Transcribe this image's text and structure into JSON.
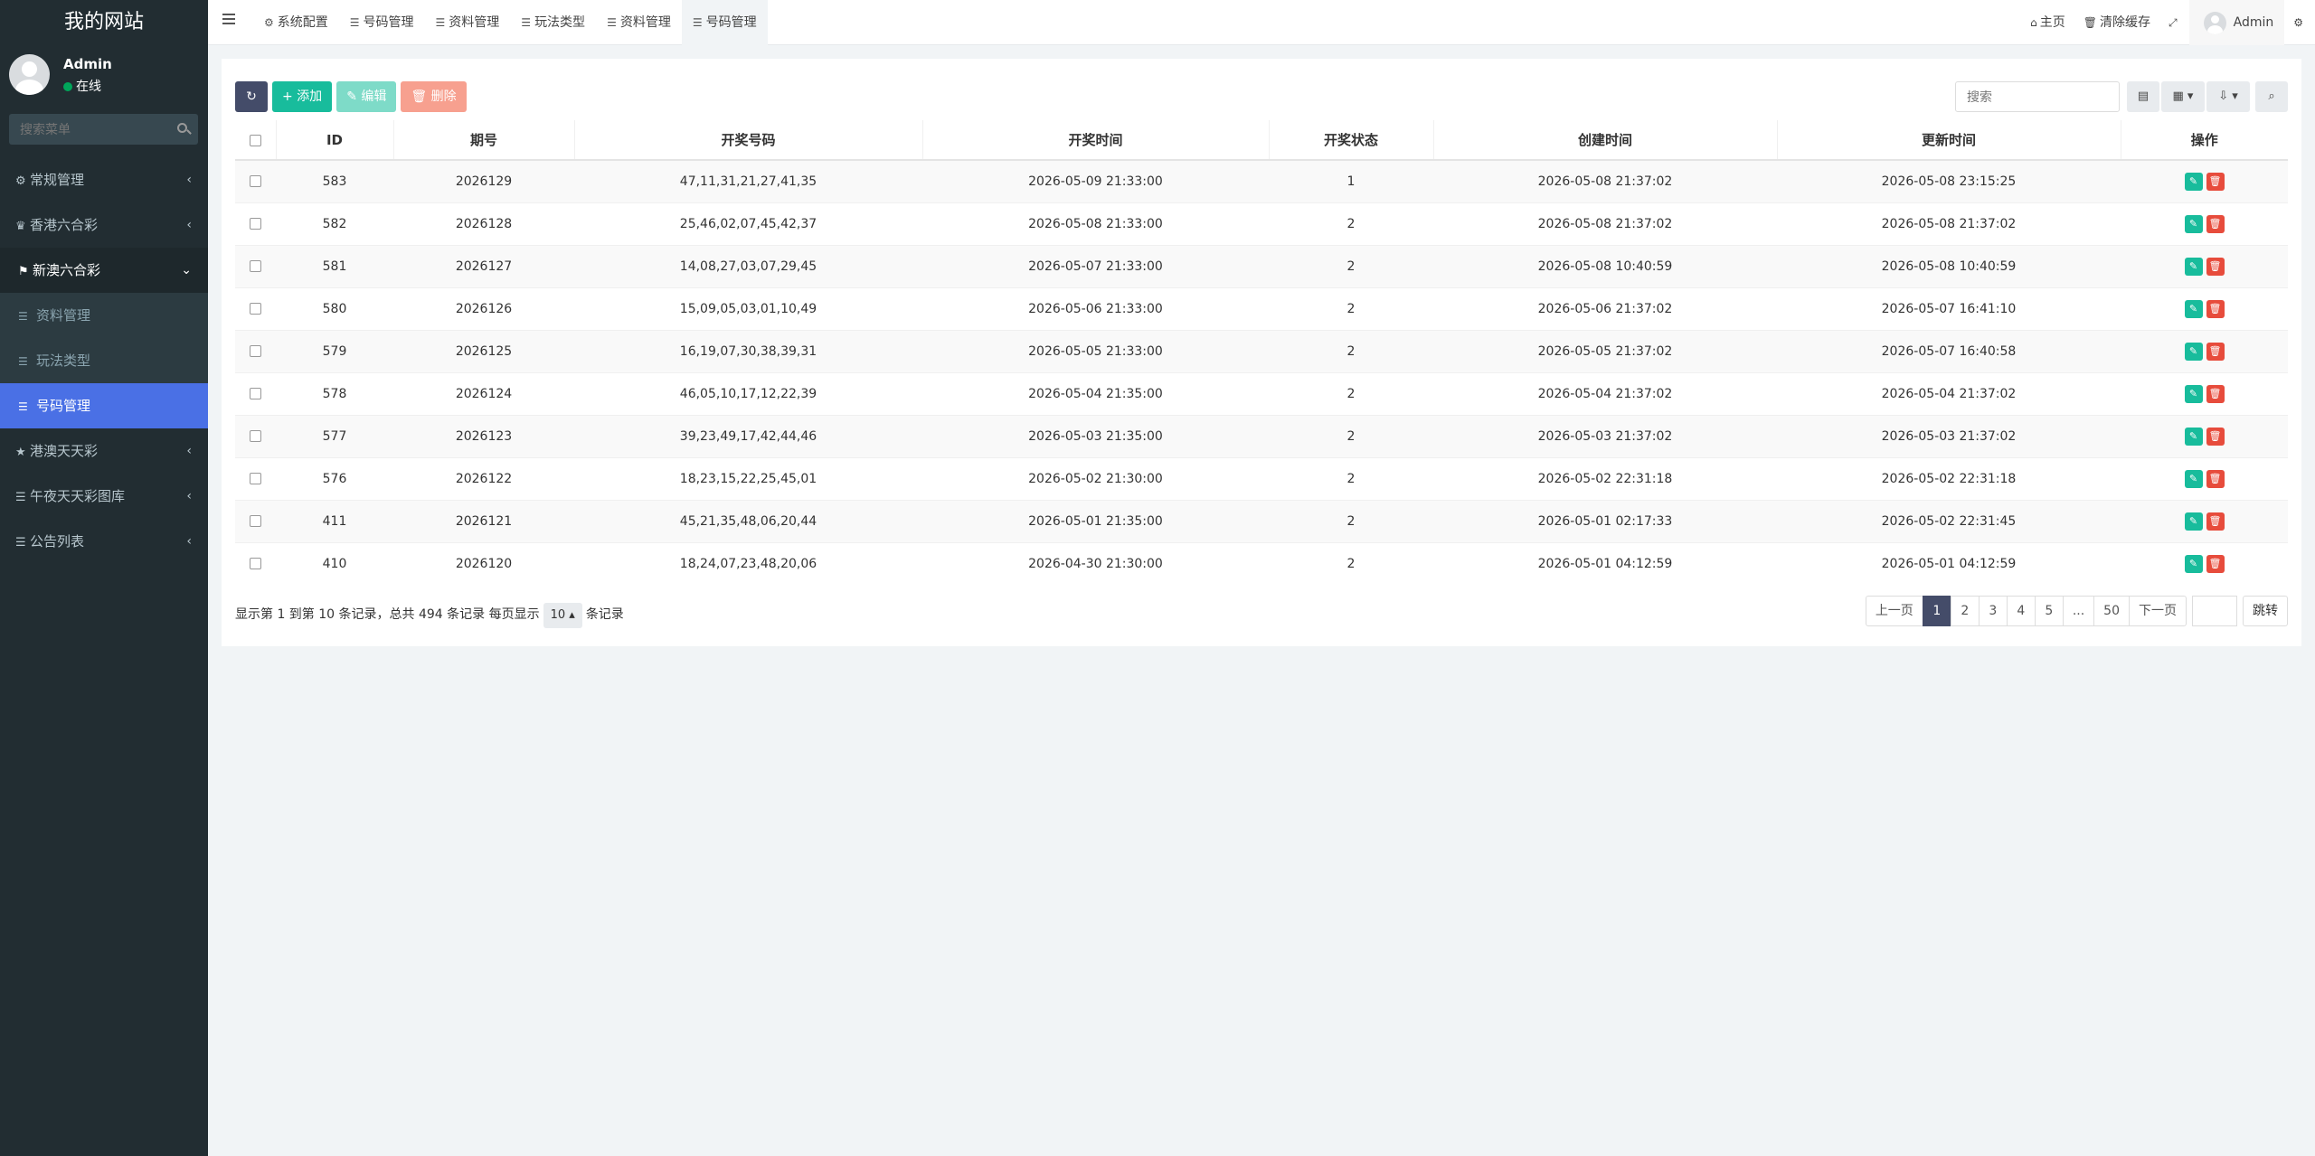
{
  "sidebar": {
    "site_title": "我的网站",
    "user_name": "Admin",
    "user_status": "在线",
    "search_placeholder": "搜索菜单",
    "menu": {
      "general": "常规管理",
      "hk": "香港六合彩",
      "macau": "新澳六合彩",
      "macau_sub": [
        "资料管理",
        "玩法类型",
        "号码管理"
      ],
      "gangao": "港澳天天彩",
      "wuye": "午夜天天彩图库",
      "notice": "公告列表"
    }
  },
  "navbar": {
    "tabs": [
      "系统配置",
      "号码管理",
      "资料管理",
      "玩法类型",
      "资料管理",
      "号码管理"
    ],
    "home": "主页",
    "clear_cache": "清除缓存",
    "user": "Admin"
  },
  "toolbar": {
    "add": "添加",
    "edit": "编辑",
    "delete": "删除",
    "search_placeholder": "搜索"
  },
  "table": {
    "headers": [
      "ID",
      "期号",
      "开奖号码",
      "开奖时间",
      "开奖状态",
      "创建时间",
      "更新时间",
      "操作"
    ],
    "rows": [
      [
        "583",
        "2026129",
        "47,11,31,21,27,41,35",
        "2026-05-09 21:33:00",
        "1",
        "2026-05-08 21:37:02",
        "2026-05-08 23:15:25"
      ],
      [
        "582",
        "2026128",
        "25,46,02,07,45,42,37",
        "2026-05-08 21:33:00",
        "2",
        "2026-05-08 21:37:02",
        "2026-05-08 21:37:02"
      ],
      [
        "581",
        "2026127",
        "14,08,27,03,07,29,45",
        "2026-05-07 21:33:00",
        "2",
        "2026-05-08 10:40:59",
        "2026-05-08 10:40:59"
      ],
      [
        "580",
        "2026126",
        "15,09,05,03,01,10,49",
        "2026-05-06 21:33:00",
        "2",
        "2026-05-06 21:37:02",
        "2026-05-07 16:41:10"
      ],
      [
        "579",
        "2026125",
        "16,19,07,30,38,39,31",
        "2026-05-05 21:33:00",
        "2",
        "2026-05-05 21:37:02",
        "2026-05-07 16:40:58"
      ],
      [
        "578",
        "2026124",
        "46,05,10,17,12,22,39",
        "2026-05-04 21:35:00",
        "2",
        "2026-05-04 21:37:02",
        "2026-05-04 21:37:02"
      ],
      [
        "577",
        "2026123",
        "39,23,49,17,42,44,46",
        "2026-05-03 21:35:00",
        "2",
        "2026-05-03 21:37:02",
        "2026-05-03 21:37:02"
      ],
      [
        "576",
        "2026122",
        "18,23,15,22,25,45,01",
        "2026-05-02 21:30:00",
        "2",
        "2026-05-02 22:31:18",
        "2026-05-02 22:31:18"
      ],
      [
        "411",
        "2026121",
        "45,21,35,48,06,20,44",
        "2026-05-01 21:35:00",
        "2",
        "2026-05-01 02:17:33",
        "2026-05-02 22:31:45"
      ],
      [
        "410",
        "2026120",
        "18,24,07,23,48,20,06",
        "2026-04-30 21:30:00",
        "2",
        "2026-05-01 04:12:59",
        "2026-05-01 04:12:59"
      ]
    ]
  },
  "pagination": {
    "info_prefix": "显示第 1 到第 10 条记录，总共 494 条记录 每页显示",
    "page_size": "10",
    "info_suffix": "条记录",
    "prev": "上一页",
    "pages": [
      "1",
      "2",
      "3",
      "4",
      "5",
      "...",
      "50"
    ],
    "next": "下一页",
    "jump": "跳转"
  },
  "colors": {
    "sidebar_bg": "#222d32",
    "active_blue": "#4a70e5",
    "success": "#18bc9c",
    "danger": "#e74c3c",
    "dark_btn": "#444c69"
  }
}
